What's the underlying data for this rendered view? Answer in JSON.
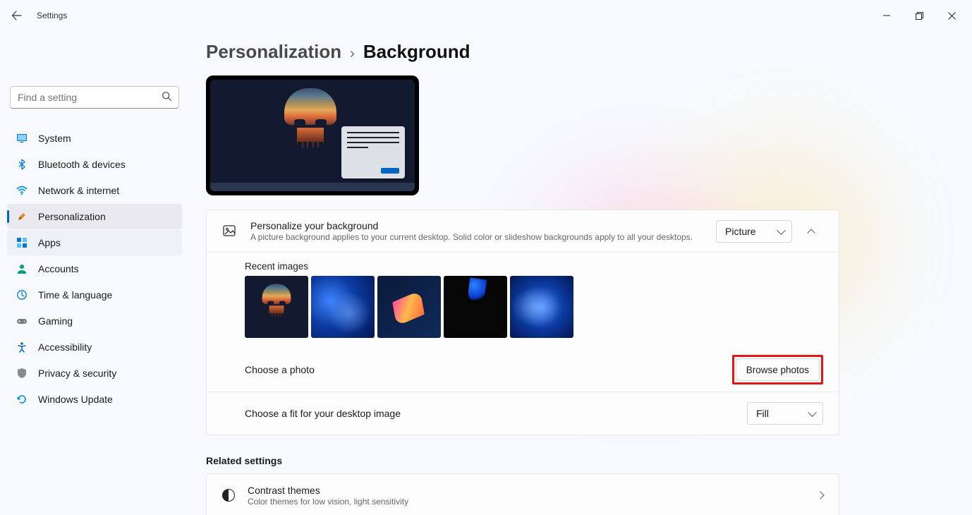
{
  "window": {
    "title": "Settings"
  },
  "search": {
    "placeholder": "Find a setting"
  },
  "sidebar": {
    "items": [
      {
        "label": "System"
      },
      {
        "label": "Bluetooth & devices"
      },
      {
        "label": "Network & internet"
      },
      {
        "label": "Personalization"
      },
      {
        "label": "Apps"
      },
      {
        "label": "Accounts"
      },
      {
        "label": "Time & language"
      },
      {
        "label": "Gaming"
      },
      {
        "label": "Accessibility"
      },
      {
        "label": "Privacy & security"
      },
      {
        "label": "Windows Update"
      }
    ]
  },
  "breadcrumb": {
    "parent": "Personalization",
    "current": "Background"
  },
  "personalize": {
    "title": "Personalize your background",
    "subtitle": "A picture background applies to your current desktop. Solid color or slideshow backgrounds apply to all your desktops.",
    "dropdown_value": "Picture"
  },
  "recent": {
    "label": "Recent images"
  },
  "choose_photo": {
    "label": "Choose a photo",
    "button": "Browse photos"
  },
  "fit": {
    "label": "Choose a fit for your desktop image",
    "dropdown_value": "Fill"
  },
  "related": {
    "heading": "Related settings",
    "contrast_title": "Contrast themes",
    "contrast_sub": "Color themes for low vision, light sensitivity"
  }
}
